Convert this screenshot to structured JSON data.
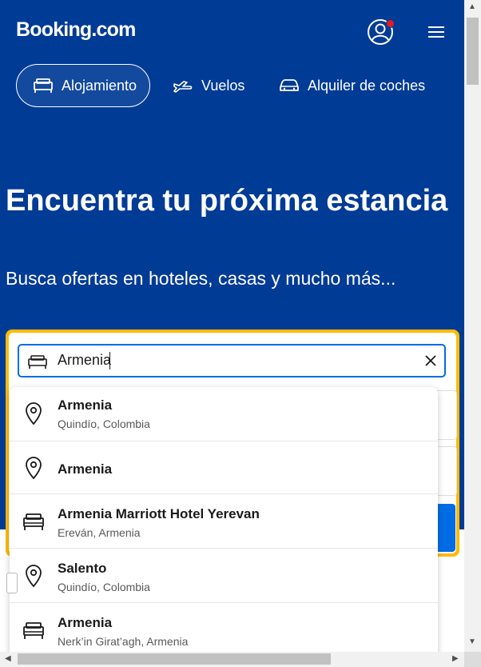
{
  "header": {
    "logo": "Booking.com",
    "account_icon": "user-circle-icon",
    "menu_icon": "hamburger-menu-icon",
    "notification_color": "#e21c24"
  },
  "nav": {
    "tabs": [
      {
        "label": "Alojamiento",
        "icon": "bed-icon",
        "active": true
      },
      {
        "label": "Vuelos",
        "icon": "plane-icon",
        "active": false
      },
      {
        "label": "Alquiler de coches",
        "icon": "car-icon",
        "active": false
      }
    ]
  },
  "hero": {
    "title": "Encuentra tu próxima estancia",
    "subtitle": "Busca ofertas en hoteles, casas y mucho más..."
  },
  "search": {
    "destination_value": "Armenia",
    "clear_icon": "close-icon",
    "border_color": "#febb02",
    "focus_color": "#006ce4"
  },
  "suggestions": [
    {
      "title": "Armenia",
      "subtitle": "Quindío, Colombia",
      "icon": "map-pin-icon"
    },
    {
      "title": "Armenia",
      "subtitle": "",
      "icon": "map-pin-icon"
    },
    {
      "title": "Armenia Marriott Hotel Yerevan",
      "subtitle": "Ereván, Armenia",
      "icon": "bed-icon"
    },
    {
      "title": "Salento",
      "subtitle": "Quindío, Colombia",
      "icon": "map-pin-icon"
    },
    {
      "title": "Armenia",
      "subtitle": "Nerk’in Girat’agh, Armenia",
      "icon": "bed-icon"
    }
  ],
  "colors": {
    "brand_blue": "#003b95",
    "accent_blue": "#006ce4",
    "yellow": "#febb02"
  }
}
